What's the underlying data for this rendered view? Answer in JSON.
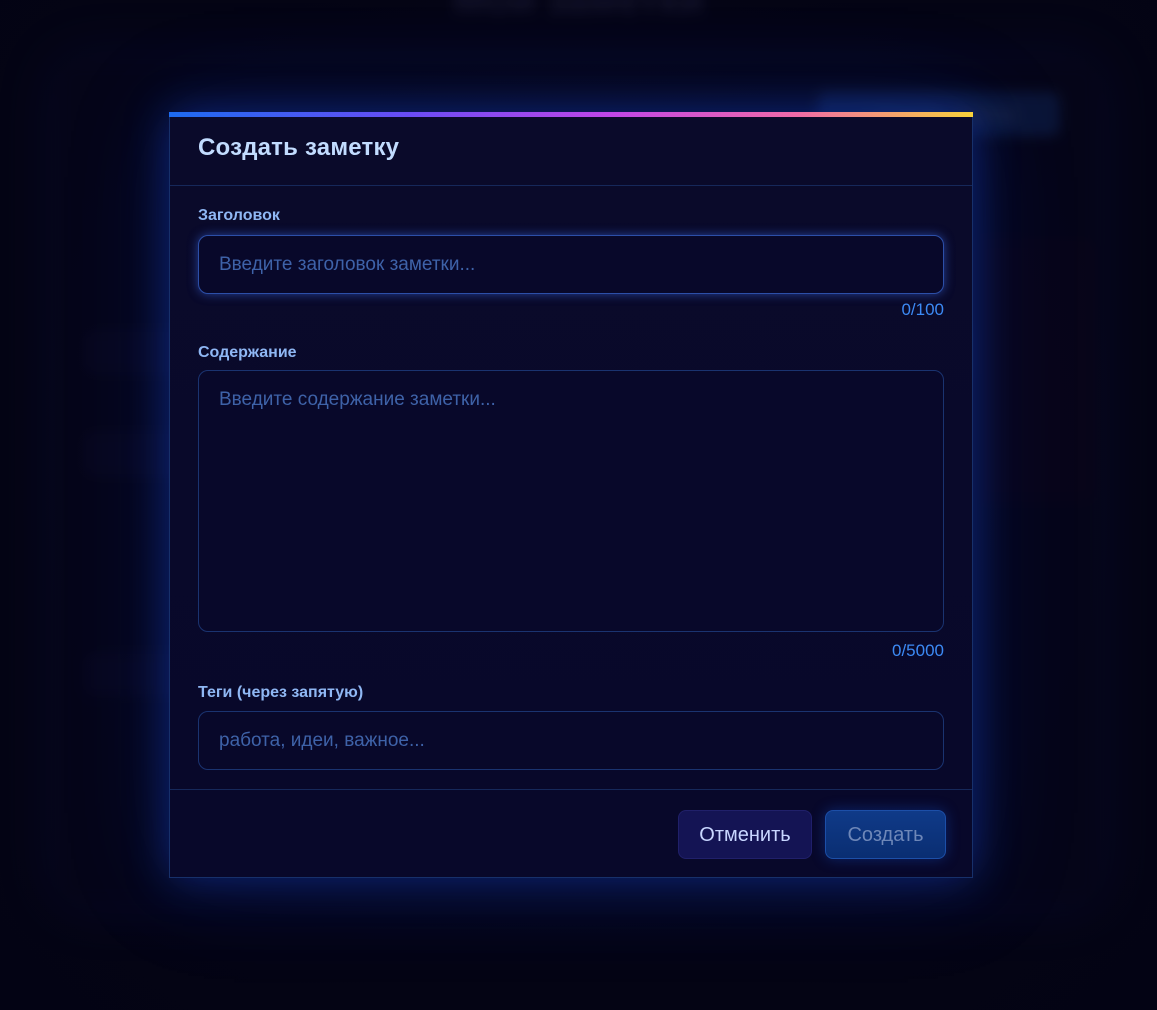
{
  "background": {
    "app_title": "Мои заметки",
    "create_button_label": "+ Создать заметку"
  },
  "modal": {
    "title": "Создать заметку",
    "title_field": {
      "label": "Заголовок",
      "placeholder": "Введите заголовок заметки...",
      "value": "",
      "counter": "0/100"
    },
    "content_field": {
      "label": "Содержание",
      "placeholder": "Введите содержание заметки...",
      "value": "",
      "counter": "0/5000"
    },
    "tags_field": {
      "label": "Теги (через запятую)",
      "placeholder": "работа, идеи, важное...",
      "value": ""
    },
    "buttons": {
      "cancel": "Отменить",
      "create": "Создать"
    }
  },
  "colors": {
    "accent_gradient": [
      "#1d6bf0",
      "#6a4cf5",
      "#c046e8",
      "#f06aa8",
      "#f8d23a"
    ],
    "title_text": "#c2dcff",
    "label_text": "#8fb7f4",
    "counter_text": "#3c8af5",
    "modal_border": "#17306a"
  }
}
